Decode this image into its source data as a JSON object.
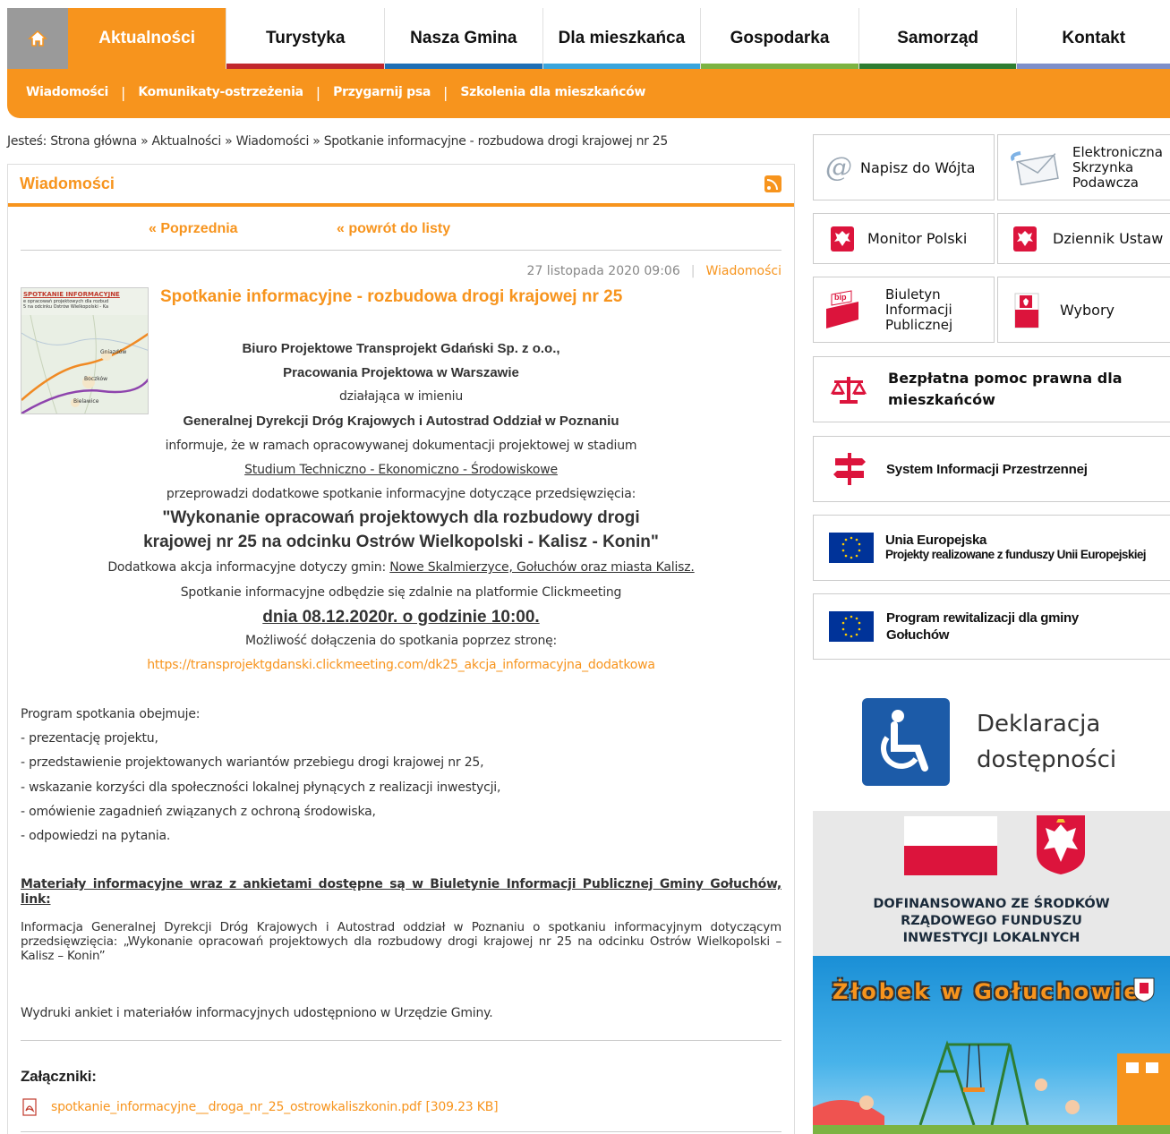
{
  "nav": {
    "home_icon": "home-icon",
    "tabs": [
      {
        "label": "Aktualności",
        "bar": "#f7941d"
      },
      {
        "label": "Turystyka",
        "bar": "#c1272d"
      },
      {
        "label": "Nasza Gmina",
        "bar": "#1f6fb5"
      },
      {
        "label": "Dla mieszkańca",
        "bar": "#3aa5dc"
      },
      {
        "label": "Gospodarka",
        "bar": "#7cb342"
      },
      {
        "label": "Samorząd",
        "bar": "#2e7d32"
      },
      {
        "label": "Kontakt",
        "bar": "#7e8fc9"
      }
    ]
  },
  "subnav": [
    "Wiadomości",
    "Komunikaty-ostrzeżenia",
    "Przygarnij psa",
    "Szkolenia dla mieszkańców"
  ],
  "breadcrumb": "Jesteś: Strona główna » Aktualności » Wiadomości » Spotkanie informacyjne - rozbudowa drogi krajowej nr 25",
  "box_title": "Wiadomości",
  "prev_label": "« Poprzednia",
  "back_label": "« powrót do listy",
  "article": {
    "date": "27 listopada 2020 09:06",
    "category": "Wiadomości",
    "title": "Spotkanie informacyjne - rozbudowa drogi krajowej nr 25",
    "thumb_lines": [
      "SPOTKANIE INFORMACYJNE",
      "e opracowań projektowych dla rozbud",
      "5 na odcinku Ostrów Wielkopolski - Ka"
    ],
    "thumb_places": [
      "Gniazdów",
      "Boczków",
      "Bielawice"
    ],
    "l1": "Biuro Projektowe Transprojekt Gdański Sp. z o.o.,",
    "l2": "Pracowania Projektowa w Warszawie",
    "l3": "działająca w imieniu",
    "l4": "Generalnej Dyrekcji Dróg Krajowych i Autostrad Oddział w Poznaniu",
    "l5": "informuje, że w ramach opracowywanej dokumentacji projektowej w stadium",
    "l6": "Studium Techniczno - Ekonomiczno - Środowiskowe",
    "l7": "przeprowadzi dodatkowe spotkanie informacyjne dotyczące przedsięwzięcia:",
    "l8": "\"Wykonanie opracowań projektowych dla rozbudowy drogi",
    "l9": "krajowej nr 25 na odcinku Ostrów Wielkopolski - Kalisz - Konin\"",
    "l10a": "Dodatkowa akcja informacyjne dotyczy gmin: ",
    "l10b": "Nowe Skalmierzyce, Gołuchów oraz miasta Kalisz.",
    "l11": "Spotkanie informacyjne odbędzie się zdalnie na platformie Clickmeeting",
    "l12": "dnia 08.12.2020r. o godzinie 10:00.",
    "l13": "Możliwość dołączenia do spotkania poprzez stronę:",
    "l14": "https://transprojektgdanski.clickmeeting.com/dk25_akcja_informacyjna_dodatkowa",
    "program_title": "Program spotkania obejmuje:",
    "program": [
      "- prezentację projektu,",
      "- przedstawienie projektowanych wariantów przebiegu drogi krajowej nr 25,",
      "- wskazanie korzyści dla społeczności lokalnej płynących z realizacji inwestycji,",
      "- omówienie zagadnień związanych z ochroną środowiska,",
      "- odpowiedzi na pytania."
    ],
    "materials_heading": "Materiały informacyjne wraz z ankietami dostępne są w Biuletynie Informacji Publicznej Gminy Gołuchów, link:",
    "materials_link": "Informacja Generalnej Dyrekcji Dróg Krajowych i Autostrad oddział w Poznaniu o spotkaniu informacyjnym dotyczącym przedsięwzięcia: „Wykonanie opracowań projektowych dla rozbudowy drogi krajowej nr 25 na odcinku Ostrów Wielkopolski – Kalisz – Konin”",
    "printouts": "Wydruki ankiet i materiałów informacyjnych udostępniono w Urzędzie Gminy.",
    "attachments_heading": "Załączniki:",
    "attachment_name": "spotkanie_informacyjne__droga_nr_25_ostrowkaliszkonin.pdf",
    "attachment_size": "[309.23 KB]"
  },
  "sidebar": {
    "napisz": "Napisz do Wójta",
    "eskrzynka": [
      "Elektroniczna",
      "Skrzynka",
      "Podawcza"
    ],
    "monitor": "Monitor Polski",
    "dziennik": "Dziennik Ustaw",
    "bip": [
      "Biuletyn",
      "Informacji",
      "Publicznej"
    ],
    "bip_tag": "bip",
    "wybory": "Wybory",
    "pomoc": [
      "Bezpłatna pomoc prawna dla",
      "mieszkańców"
    ],
    "sip": "System Informacji Przestrzennej",
    "ue_title": "Unia Europejska",
    "ue_sub": "Projekty realizowane z funduszy Unii Europejskiej",
    "rewit": [
      "Program rewitalizacji dla gminy",
      "Gołuchów"
    ],
    "deklaracja": [
      "Deklaracja",
      "dostępności"
    ],
    "fund": [
      "DOFINANSOWANO ZE ŚRODKÓW",
      "RZĄDOWEGO FUNDUSZU",
      "INWESTYCJI LOKALNYCH"
    ],
    "zlobek": "Żłobek w Gołuchowie"
  },
  "colors": {
    "accent": "#f7941d",
    "poland_red": "#dc143c",
    "eu_blue": "#003399",
    "access_blue": "#1c5ba8"
  }
}
